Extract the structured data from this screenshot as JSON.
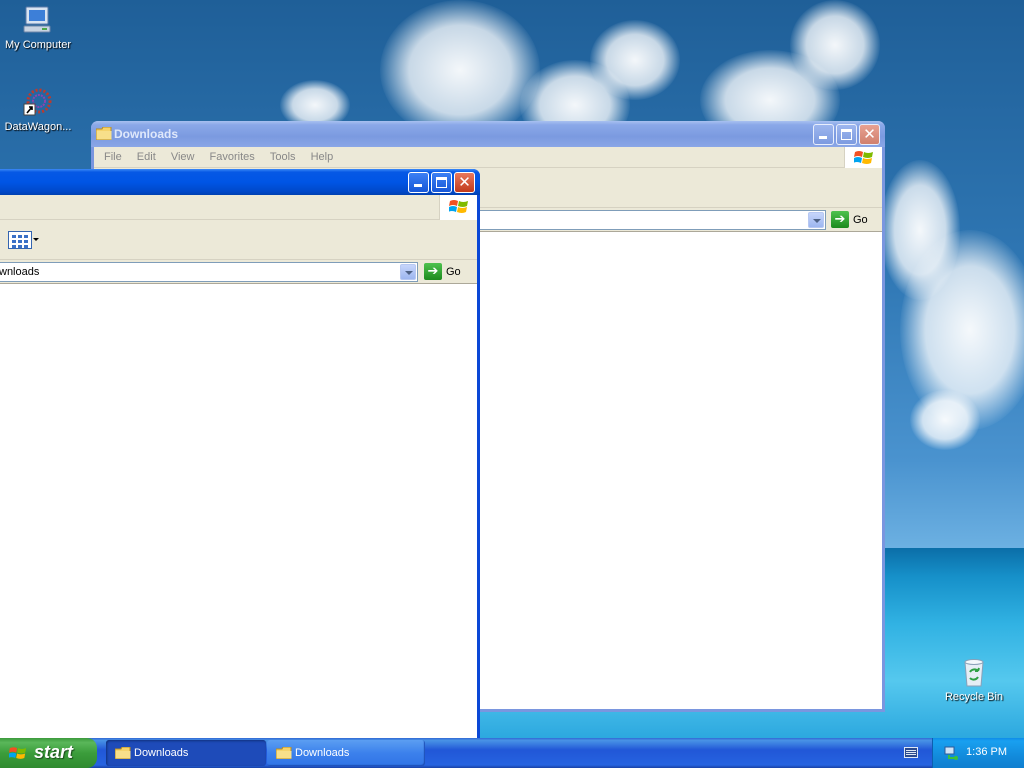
{
  "desktop": {
    "icons": [
      {
        "label": "My Computer",
        "icon": "computer-icon"
      },
      {
        "label": "DataWagon...",
        "icon": "datawagon-icon"
      },
      {
        "label": "Recycle Bin",
        "icon": "recycle-bin-icon"
      }
    ]
  },
  "back_window": {
    "title": "Downloads",
    "menu": [
      "File",
      "Edit",
      "View",
      "Favorites",
      "Tools",
      "Help"
    ],
    "go_label": "Go",
    "active": false
  },
  "front_window": {
    "address": "wnloads",
    "go_label": "Go",
    "active": true
  },
  "taskbar": {
    "start_label": "start",
    "tasks": [
      {
        "label": "Downloads",
        "pressed": true
      },
      {
        "label": "Downloads",
        "pressed": false
      }
    ],
    "clock": "1:36 PM"
  },
  "colors": {
    "title_active": "#0055e5",
    "title_inactive": "#7b9ae0",
    "taskbar": "#2457d3",
    "start_button": "#3b9d3b",
    "tray": "#128bdc"
  }
}
